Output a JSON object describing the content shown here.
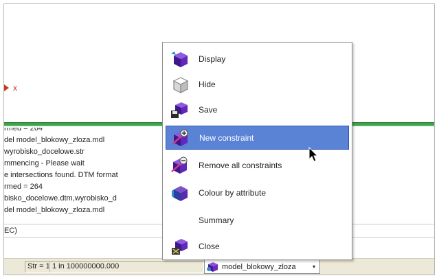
{
  "viewport": {
    "axis_label": "x"
  },
  "report": {
    "lines": [
      "rmed = 264",
      "del model_blokowy_zloza.mdl",
      "wyrobisko_docelowe.str",
      "mmencing - Please wait",
      "e intersections found. DTM format",
      "rmed = 264",
      "bisko_docelowe.dtm,wyrobisko_d",
      "del model_blokowy_zloza.mdl"
    ]
  },
  "command": {
    "text": "EC)"
  },
  "status_bar": {
    "str_label": "Str = 1",
    "scale_label": "1 in 100000000.000",
    "layer_value": "model_blokowy_zloza",
    "layer_arrow": "▾"
  },
  "context_menu": {
    "items": [
      {
        "label": "Display",
        "icon": "display-icon"
      },
      {
        "label": "Hide",
        "icon": "hide-icon"
      },
      {
        "label": "Save",
        "icon": "save-icon"
      },
      {
        "label": "New constraint",
        "icon": "new-constraint-icon"
      },
      {
        "label": "Remove all constraints",
        "icon": "remove-constraints-icon"
      },
      {
        "label": "Colour by attribute",
        "icon": "colour-by-attribute-icon"
      },
      {
        "label": "Summary",
        "icon": ""
      },
      {
        "label": "Close",
        "icon": "close-icon"
      }
    ],
    "highlighted_index": 3
  },
  "colors": {
    "accent_divider": "#3fa34b",
    "highlight": "#5a83d6",
    "axis": "#c83a1e",
    "cube_purple": "#5b1fa8"
  }
}
